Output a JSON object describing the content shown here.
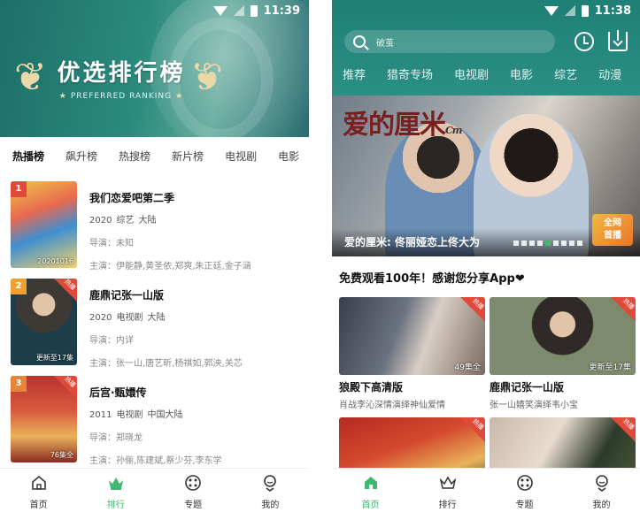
{
  "left": {
    "status": {
      "time": "11:39"
    },
    "banner": {
      "title": "优选排行榜",
      "subtitle": "PREFERRED RANKING"
    },
    "tabs": [
      "热播榜",
      "飙升榜",
      "热搜榜",
      "新片榜",
      "电视剧",
      "电影"
    ],
    "items": [
      {
        "rank": "1",
        "title": "我们恋爱吧第二季",
        "year": "2020",
        "genre": "综艺",
        "region": "大陆",
        "director": "导演：未知",
        "cast": "主演：伊能静,黄圣依,郑爽,朱正廷,金子涵",
        "episode": "20201016",
        "hot": false
      },
      {
        "rank": "2",
        "title": "鹿鼎记张一山版",
        "year": "2020",
        "genre": "电视剧",
        "region": "大陆",
        "director": "导演：内详",
        "cast": "主演：张一山,唐艺昕,杨祺如,郭泱,关芯",
        "episode": "更新至17集",
        "hot": true,
        "hot_label": "热播"
      },
      {
        "rank": "3",
        "title": "后宫·甄嬛传",
        "year": "2011",
        "genre": "电视剧",
        "region": "中国大陆",
        "director": "导演：郑晓龙",
        "cast": "主演：孙俪,陈建斌,蔡少芬,李东学",
        "episode": "76集全",
        "hot": true,
        "hot_label": "热播"
      }
    ],
    "nav": [
      {
        "label": "首页",
        "icon": "home-icon"
      },
      {
        "label": "排行",
        "icon": "crown-icon",
        "active": true
      },
      {
        "label": "专题",
        "icon": "topic-icon"
      },
      {
        "label": "我的",
        "icon": "profile-icon"
      }
    ]
  },
  "right": {
    "status": {
      "time": "11:38"
    },
    "search": {
      "placeholder": "破茧"
    },
    "categories": [
      "推荐",
      "猎奇专场",
      "电视剧",
      "电影",
      "综艺",
      "动漫"
    ],
    "hero": {
      "logo": "爱的厘米",
      "logo_sub": "Cm",
      "caption": "爱的厘米: 佟丽娅恋上佟大为",
      "badge_line1": "全网",
      "badge_line2": "首播",
      "dot_count": 9,
      "active_dot": 4
    },
    "section_title": "免费观看100年！感谢您分享App",
    "heart": "❤",
    "cards": [
      {
        "title": "狼殿下高清版",
        "subtitle": "肖战李沁深情演绎神仙爱情",
        "episode": "49集全",
        "hot_label": "热播"
      },
      {
        "title": "鹿鼎记张一山版",
        "subtitle": "张一山嬉笑演绎韦小宝",
        "episode": "更新至17集",
        "hot_label": "热播"
      },
      {
        "title": "",
        "subtitle": "",
        "episode": "",
        "hot_label": "热播"
      },
      {
        "title": "",
        "subtitle": "",
        "episode": "",
        "hot_label": "热播"
      }
    ],
    "nav": [
      {
        "label": "首页",
        "icon": "home-icon",
        "active": true
      },
      {
        "label": "排行",
        "icon": "crown-icon"
      },
      {
        "label": "专题",
        "icon": "topic-icon"
      },
      {
        "label": "我的",
        "icon": "profile-icon"
      }
    ]
  },
  "colors": {
    "accent": "#3fb96f",
    "header_teal": "#1f7f76",
    "hot_red": "#e04a3b"
  }
}
